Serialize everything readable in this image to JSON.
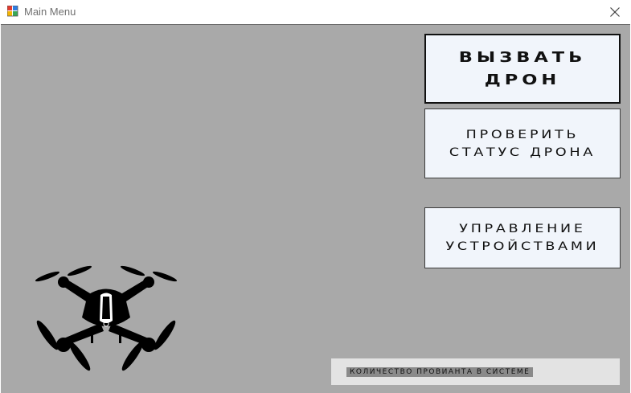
{
  "window": {
    "title": "Main Menu",
    "close_icon": "close-icon",
    "app_icon": "windows-form-icon"
  },
  "menu": {
    "call_drone": "Вызвать дрон",
    "check_status": "Проверить статус дрона",
    "manage_devices": "Управление устройствами"
  },
  "status": {
    "provision_count_label": "Количество провианта в системе"
  },
  "image": {
    "icon": "drone-icon"
  },
  "colors": {
    "client_bg": "#a9a9a9",
    "button_bg": "#f1f5fb",
    "status_panel_bg": "#e3e3e3",
    "status_label_bg": "#8a8a8a"
  }
}
